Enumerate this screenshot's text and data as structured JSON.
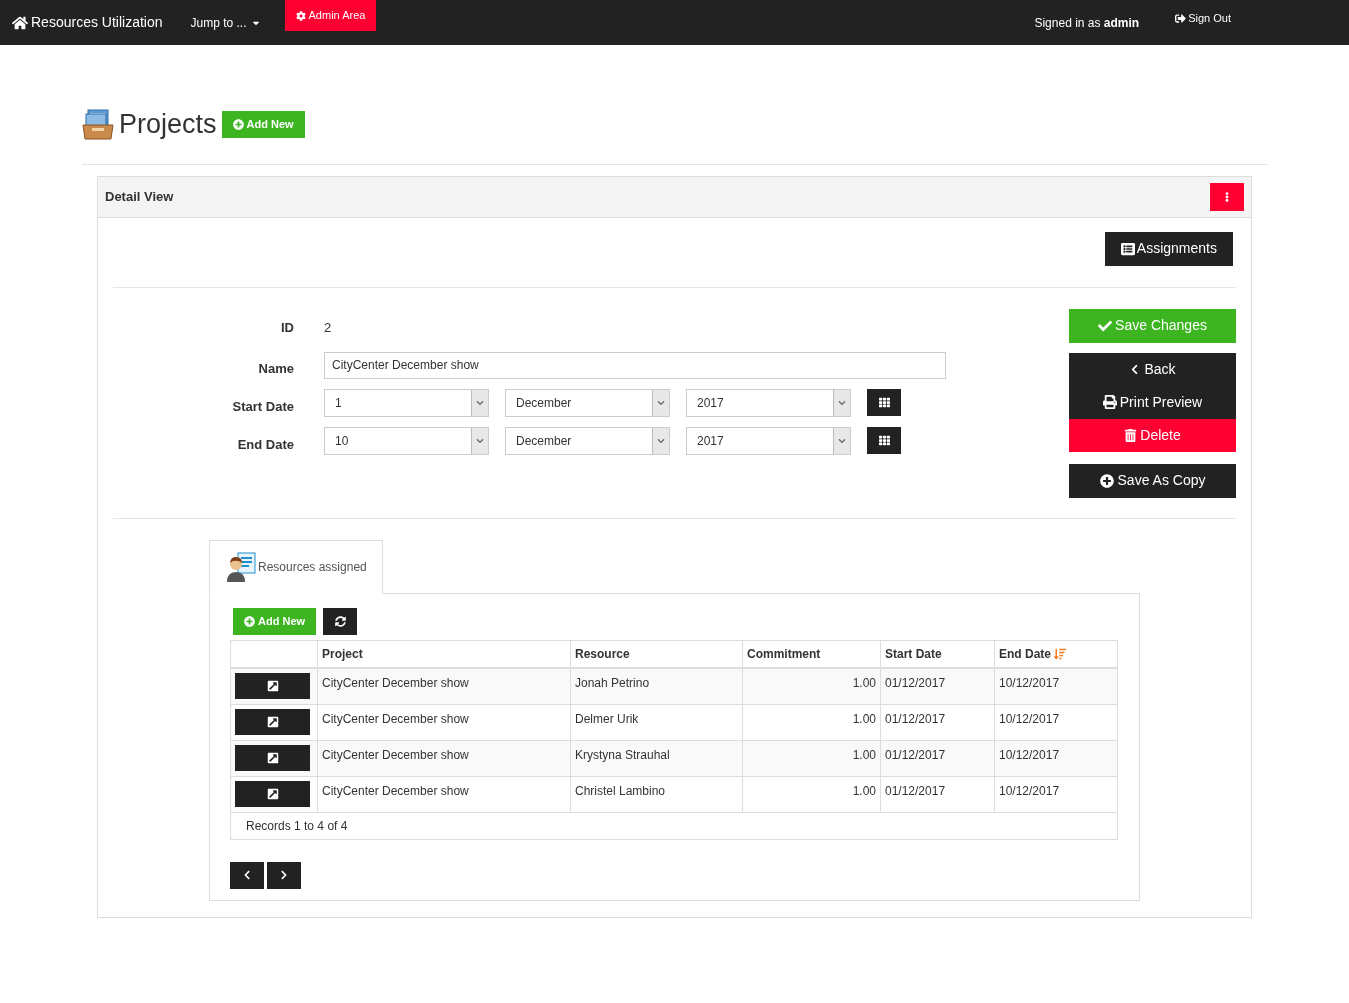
{
  "navbar": {
    "brand": "Resources Utilization",
    "jump_to": "Jump to ...",
    "admin_area": "Admin Area",
    "signed_in": "Signed in as **admin**",
    "sign_out": "Sign Out"
  },
  "page": {
    "title": "Projects",
    "add_new": "Add New"
  },
  "panel": {
    "title": "Detail View",
    "assignments": "Assignments"
  },
  "fields": [
    {
      "kind": "text",
      "label": "ID",
      "value": "2"
    },
    {
      "kind": "input",
      "label": "Name",
      "value": "CityCenter December show"
    },
    {
      "kind": "date",
      "label": "Start Date",
      "day": "1",
      "month": "December",
      "year": "2017"
    },
    {
      "kind": "date",
      "label": "End Date",
      "day": "10",
      "month": "December",
      "year": "2017"
    }
  ],
  "actions": {
    "save_changes": "Save Changes",
    "back": "Back",
    "print_preview": "Print Preview",
    "delete": "Delete",
    "save_as_copy": "Save As Copy"
  },
  "tabs": [
    {
      "label": "Resources assigned",
      "selected": true
    }
  ],
  "subtable": {
    "add_new": "Add New",
    "columns": [
      {
        "label": "Project",
        "sorted": false
      },
      {
        "label": "Resource",
        "sorted": false
      },
      {
        "label": "Commitment",
        "sorted": false
      },
      {
        "label": "Start Date",
        "sorted": false
      },
      {
        "label": "End Date",
        "sorted": true
      }
    ],
    "rows": [
      [
        "CityCenter December show",
        "Jonah Petrino",
        "1.00",
        "01/12/2017",
        "10/12/2017"
      ],
      [
        "CityCenter December show",
        "Delmer Urik",
        "1.00",
        "01/12/2017",
        "10/12/2017"
      ],
      [
        "CityCenter December show",
        "Krystyna Strauhal",
        "1.00",
        "01/12/2017",
        "10/12/2017"
      ],
      [
        "CityCenter December show",
        "Christel Lambino",
        "1.00",
        "01/12/2017",
        "10/12/2017"
      ]
    ],
    "footer": "Records 1 to 4 of 4"
  }
}
